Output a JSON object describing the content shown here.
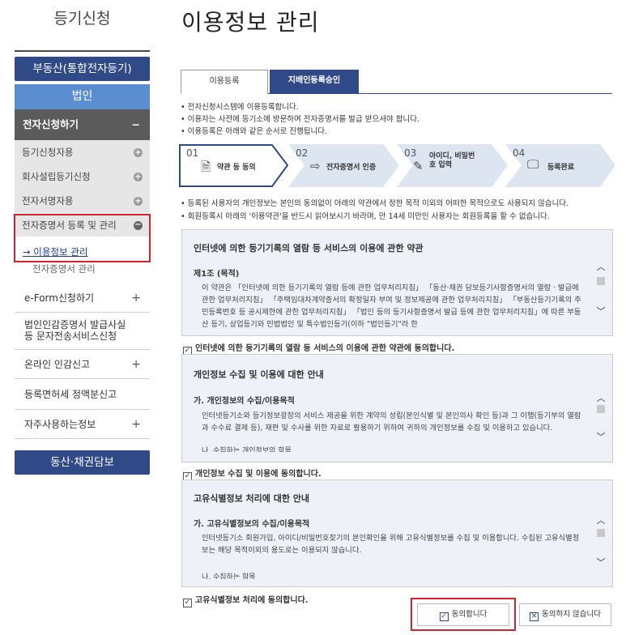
{
  "sidebar": {
    "title": "등기신청",
    "realestate_button": "부동산(통합전자등기)",
    "corp_button": "법인",
    "section_title": "전자신청하기",
    "section_toggle": "−",
    "sub_items": [
      {
        "label": "등기신청자용",
        "icon": "plus-circle-icon"
      },
      {
        "label": "회사설립등기신청",
        "icon": "plus-circle-icon"
      },
      {
        "label": "전자서명자용",
        "icon": "plus-circle-icon"
      }
    ],
    "open_item": {
      "label": "전자증명서 등록 및 관리",
      "toggle": "−",
      "active_child": "→ 이용정보 관리"
    },
    "child_item": "전자증명서 관리",
    "menu_items": [
      {
        "label": "e-Form신청하기",
        "plus": "+"
      },
      {
        "label": "법인인감증명서 발급사실 등 문자전송서비스신청",
        "plus": ""
      },
      {
        "label": "온라인 인감신고",
        "plus": "+"
      },
      {
        "label": "등록면허세 정액분신고",
        "plus": ""
      },
      {
        "label": "자주사용하는정보",
        "plus": "+"
      }
    ],
    "bottom_button": "동산·채권담보"
  },
  "main": {
    "title": "이용정보 관리",
    "tabs": [
      {
        "label": "이용등록",
        "active": true
      },
      {
        "label": "지배인등록승인",
        "active": false
      }
    ],
    "bullets": [
      "• 전자신청시스템에 이용등록합니다.",
      "• 이용자는 사전에 등기소에 방문하여 전자증명서를 발급 받으셔야 합니다.",
      "• 이용등록은 아래와 같은 순서로 진행됩니다."
    ],
    "steps": [
      {
        "num": "01",
        "label": "약관 등 동의",
        "icon": "document-icon",
        "active": true
      },
      {
        "num": "02",
        "label": "전자증명서 인증",
        "icon": "login-arrow-icon",
        "active": false
      },
      {
        "num": "03",
        "label": "아이디, 비밀번호 입력",
        "icon": "pencil-icon",
        "active": false
      },
      {
        "num": "04",
        "label": "등록완료",
        "icon": "monitor-icon",
        "active": false
      }
    ],
    "notices": [
      "• 등록된 사용자의 개인정보는 본인의 동의없이 아래의 약관에서 정한 목적 이외의 어떠한 목적으로도 사용되지 않습니다.",
      "• 회원등록시 아래의 '이용약관'을 반드시 읽어보시기 바라며, 만 14세 미만인 사용자는 회원등록을 할 수 없습니다."
    ],
    "terms": [
      {
        "title": "인터넷에 의한 등기기록의 열람 등 서비스의 이용에 관한 약관",
        "subtitle": "제1조 (목적)",
        "text": "이 약관은 「인터넷에 의한 등기기록의 열람 등에 관한 업무처리지침」 「동산·채권 담보등기사항증명서의 열람 · 발급에 관한 업무처리지침」 「주택임대차계약증서의 확정일자 부여 및 정보제공에 관한 업무처리지침」 「부동산등기기록의 주민등록번호 등 공시제한에 관한 업무처리지침」 「법인 등의 등기사항증명서 발급 등에 관한 업무처리지침」에 따른 부동산 등기, 상업등기와 민법법인 및 특수법인등기(이하 \"법인등기\"라 한",
        "agree": "인터넷에 의한 등기기록의 열람 등 서비스의 이용에 관한 약관에 동의합니다."
      },
      {
        "title": "개인정보 수집 및 이용에 대한 안내",
        "subtitle": "가. 개인정보의 수집/이용목적",
        "text": "인터넷등기소와 등기정보광장의 서비스 제공을 위한 계약의 성립(본인식별 및 본인의사 확인 등)과 그 이행(등기부의 열람과 수수료 결제 등), 재판 및 수사를 위한 자료로 활용하기 위하여 귀하의 개인정보를 수집 및 이용하고 있습니다.",
        "cut": "나. 수집하는 개인정보의 항목",
        "agree": "개인정보 수집 및 이용에 동의합니다."
      },
      {
        "title": "고유식별정보 처리에 대한 안내",
        "subtitle": "가. 고유식별정보의 수집/이용목적",
        "text": "인터넷등기소 회원가입, 아이디/비밀번호찾기의 본인확인을 위해 고유식별정보를 수집 및 이용합니다. 수집된 고유식별정보는 해당 목적이외의 용도로는 이용되지 않습니다.",
        "cut": "나. 수집하는 항목",
        "agree": "고유식별정보 처리에 동의합니다."
      }
    ],
    "agree_button": "동의합니다",
    "disagree_button": "동의하지 않습니다"
  },
  "colors": {
    "navy": "#2f4a87",
    "corp_blue": "#5b8ed0",
    "highlight_red": "#d5222b"
  }
}
